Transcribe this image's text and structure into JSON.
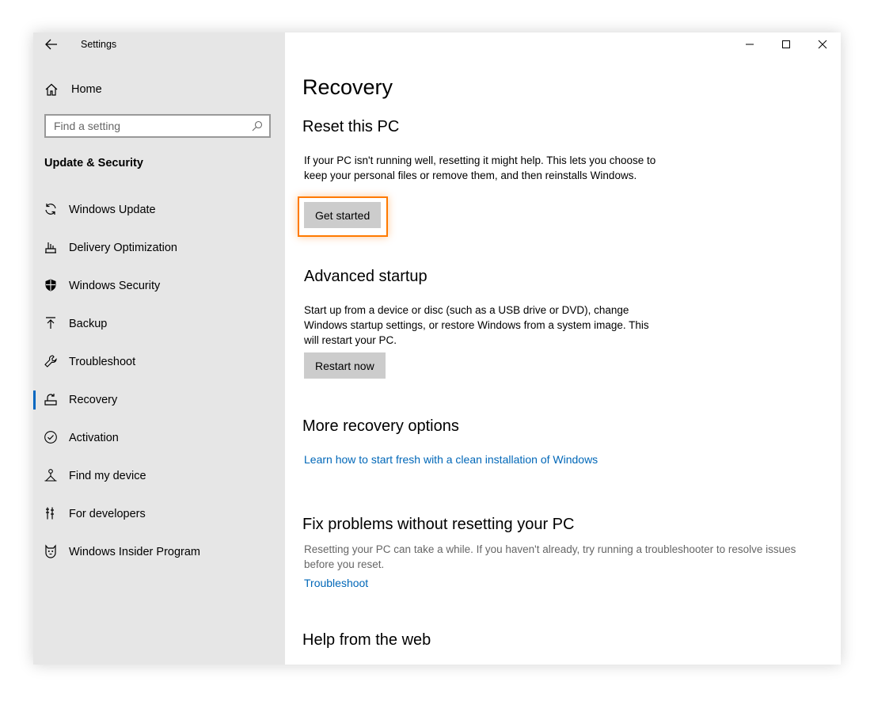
{
  "app": {
    "title": "Settings"
  },
  "sidebar": {
    "home_label": "Home",
    "search_placeholder": "Find a setting",
    "section_label": "Update & Security",
    "items": [
      {
        "label": "Windows Update",
        "icon": "refresh-icon"
      },
      {
        "label": "Delivery Optimization",
        "icon": "delivery-optimization-icon"
      },
      {
        "label": "Windows Security",
        "icon": "shield-icon"
      },
      {
        "label": "Backup",
        "icon": "backup-arrow-icon"
      },
      {
        "label": "Troubleshoot",
        "icon": "wrench-icon"
      },
      {
        "label": "Recovery",
        "icon": "recovery-icon",
        "active": true
      },
      {
        "label": "Activation",
        "icon": "check-circle-icon"
      },
      {
        "label": "Find my device",
        "icon": "find-device-icon"
      },
      {
        "label": "For developers",
        "icon": "developer-tools-icon"
      },
      {
        "label": "Windows Insider Program",
        "icon": "insider-cat-icon"
      }
    ]
  },
  "main": {
    "page_title": "Recovery",
    "reset": {
      "heading": "Reset this PC",
      "description": "If your PC isn't running well, resetting it might help. This lets you choose to keep your personal files or remove them, and then reinstalls Windows.",
      "button": "Get started"
    },
    "advanced": {
      "heading": "Advanced startup",
      "description": "Start up from a device or disc (such as a USB drive or DVD), change Windows startup settings, or restore Windows from a system image. This will restart your PC.",
      "button": "Restart now"
    },
    "more": {
      "heading": "More recovery options",
      "link": "Learn how to start fresh with a clean installation of Windows"
    },
    "fix": {
      "heading": "Fix problems without resetting your PC",
      "description": "Resetting your PC can take a while. If you haven't already, try running a troubleshooter to resolve issues before you reset.",
      "link": "Troubleshoot"
    },
    "help": {
      "heading": "Help from the web"
    }
  },
  "colors": {
    "accent": "#0067b8",
    "highlight": "#ff7a00",
    "sidebar_bg": "#e6e6e6",
    "button_bg": "#cccccc"
  }
}
